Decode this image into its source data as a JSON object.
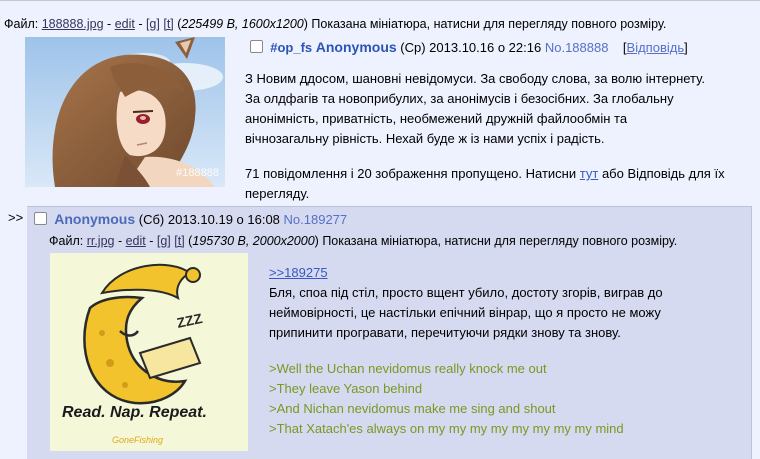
{
  "op": {
    "file_prefix": "Файл:",
    "file_name": "188888.jpg",
    "edit_label": "edit",
    "g_label": "[g]",
    "t_label": "[t]",
    "file_meta": "225499 B, 1600x1200",
    "file_hint": "Показана мініатюра, натисни для перегляду повного розміру.",
    "thumb_caption": "#188888",
    "subject": "#op_fs",
    "name": "Anonymous",
    "date": "(Ср) 2013.10.16 о 22:16",
    "post_no": "No.188888",
    "reply_label": "Відповідь",
    "body": [
      "З Новим ддосом, шановні невідомуси. За свободу слова, за волю інтернету.",
      "За олдфагів та новоприбулих, за анонімусів і безосібних. За глобальну",
      "анонімність, приватність, необмежений дружній файлообмін та",
      "вічнозагальну рівність. Нехай буде ж із нами успіх і радість."
    ],
    "omitted_before": "71 повідомлення і 20 зображення пропущено. Натисни",
    "omitted_link": "тут",
    "omitted_after": "або Відповідь для їх",
    "omitted_line2": "перегляду."
  },
  "reply": {
    "arrows": ">>",
    "name": "Anonymous",
    "date": "(Сб) 2013.10.19 о 16:08",
    "post_no": "No.189277",
    "file_prefix": "Файл:",
    "file_name": "rr.jpg",
    "edit_label": "edit",
    "g_label": "[g]",
    "t_label": "[t]",
    "file_meta": "195730 B, 2000x2000",
    "file_hint": "Показана мініатюра, натисни для перегляду повного розміру.",
    "thumb_text": "Read. Nap. Repeat.",
    "thumb_brand": "GoneFishing",
    "zzz": "ZZZ",
    "quote_link": ">>189275",
    "body": [
      "Бля, споа під стіл, просто вщент убило, достоту згорів, виграв до",
      "неймовірності, це настільки епічний вінрар, що я просто не можу",
      "припинити програвати, перечитуючи рядки знову та знову."
    ],
    "greentext": [
      ">Well the Uchan nevidomus really knock me out",
      ">They leave Yason behind",
      ">And Nichan nevidomus make me sing and shout",
      ">That Xatach'es always on my my my my my my my my mind"
    ]
  }
}
